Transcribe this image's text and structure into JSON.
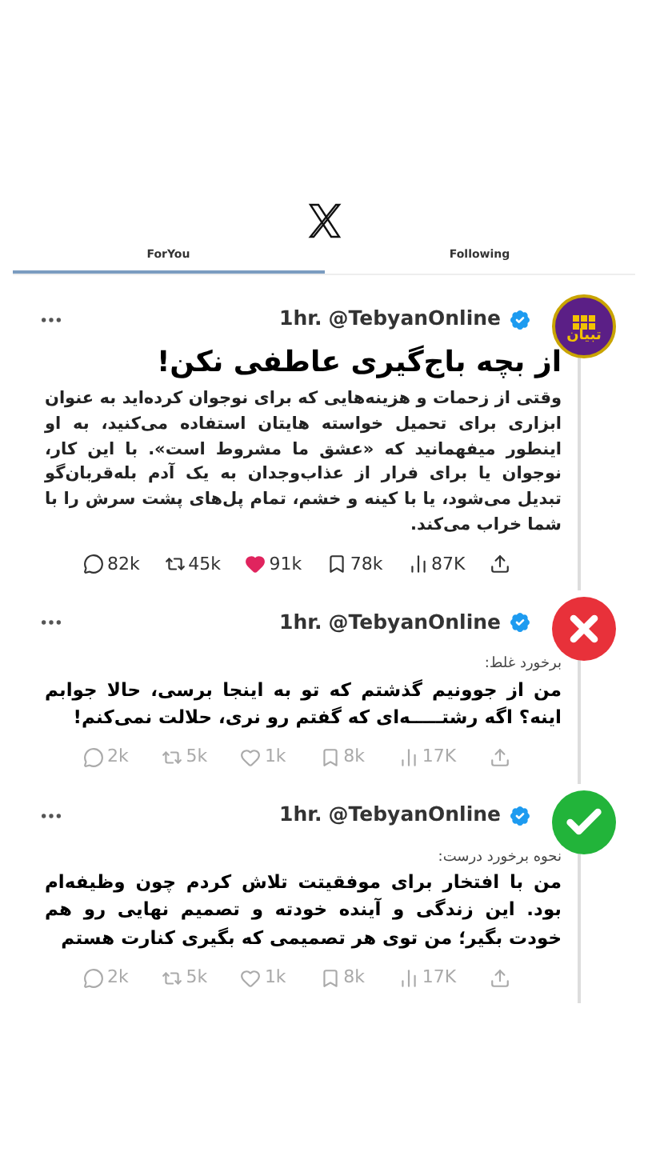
{
  "tabs": [
    {
      "label": "Following",
      "selected": false
    },
    {
      "label": "ForYou",
      "selected": true
    }
  ],
  "posts": [
    {
      "avatar": {
        "kind": "logo"
      },
      "logo_text": "تبیان",
      "handle": "@TebyanOnline",
      "time": "1hr.",
      "title": "از بچه باج‌گیری عاطفی نکن!",
      "body": "وقتی از زحمات و هزینه‌هایی که برای نوجوان کرده‌اید به عنوان ابزاری برای تحمیل خواسته هایتان استفاده می‌کنید، به او اینطور میفهمانید که «عشق ما مشروط است». با این کار، نوجوان یا برای فرار از عذاب‌وجدان به یک آدم بله‌قربان‌گو تبدیل می‌شود، یا با کینه و خشم، تمام پل‌های پشت سرش را با شما خراب می‌کند.",
      "stats": [
        {
          "kind": "share"
        },
        {
          "kind": "views",
          "text": "87K"
        },
        {
          "kind": "bookmark",
          "text": "78k"
        },
        {
          "kind": "like",
          "text": "91k",
          "liked": true
        },
        {
          "kind": "repost",
          "text": "45k"
        },
        {
          "kind": "reply",
          "text": "82k"
        }
      ]
    },
    {
      "avatar": {
        "kind": "wrong"
      },
      "handle": "@TebyanOnline",
      "time": "1hr.",
      "label": "برخورد غلط:",
      "body": "من از جوونیم گذشتم که تو به اینجا برسی، حالا جوابم اینه؟ اگه رشتـــــه‌ای که گفتم رو نری، حلالت نمی‌کنم!",
      "stats": [
        {
          "kind": "share"
        },
        {
          "kind": "views",
          "text": "17K"
        },
        {
          "kind": "bookmark",
          "text": "8k"
        },
        {
          "kind": "like",
          "text": "1k",
          "liked": false
        },
        {
          "kind": "repost",
          "text": "5k"
        },
        {
          "kind": "reply",
          "text": "2k"
        }
      ]
    },
    {
      "avatar": {
        "kind": "right"
      },
      "handle": "@TebyanOnline",
      "time": "1hr.",
      "label": "نحوه برخورد درست:",
      "body": "من با افتخار برای موفقیتت تلاش کردم چون وظیفه‌ام بود. این زندگی و آینده خودته و تصمیم نهایی رو هم خودت بگیر؛ من توی هر تصمیمی که بگیری کنارت هستم",
      "stats": [
        {
          "kind": "share"
        },
        {
          "kind": "views",
          "text": "17K"
        },
        {
          "kind": "bookmark",
          "text": "8k"
        },
        {
          "kind": "like",
          "text": "1k",
          "liked": false
        },
        {
          "kind": "repost",
          "text": "5k"
        },
        {
          "kind": "reply",
          "text": "2k"
        }
      ]
    }
  ]
}
